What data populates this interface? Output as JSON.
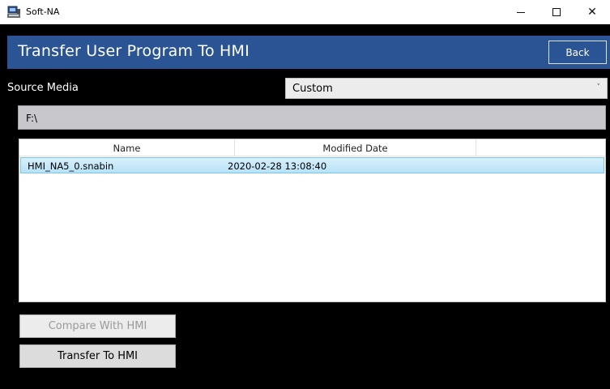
{
  "window": {
    "title": "Soft-NA",
    "minimize_glyph": "–",
    "maximize_glyph": "□",
    "close_glyph": "✕"
  },
  "header": {
    "title": "Transfer User Program To HMI",
    "back_label": "Back"
  },
  "source": {
    "label": "Source Media",
    "selected": "Custom",
    "path": "F:\\"
  },
  "file_list": {
    "columns": [
      "Name",
      "Modified Date"
    ],
    "rows": [
      {
        "name": "HMI_NA5_0.snabin",
        "modified": "2020-02-28 13:08:40",
        "selected": true
      }
    ]
  },
  "actions": {
    "compare_label": "Compare With HMI",
    "compare_enabled": false,
    "transfer_label": "Transfer To HMI"
  },
  "colors": {
    "header_bg": "#2a5493",
    "selection_bg": "#b7e2f7",
    "app_bg": "#000000"
  },
  "icons": {
    "app": "monitor-printer-icon",
    "dropdown": "chevron-down-icon"
  }
}
